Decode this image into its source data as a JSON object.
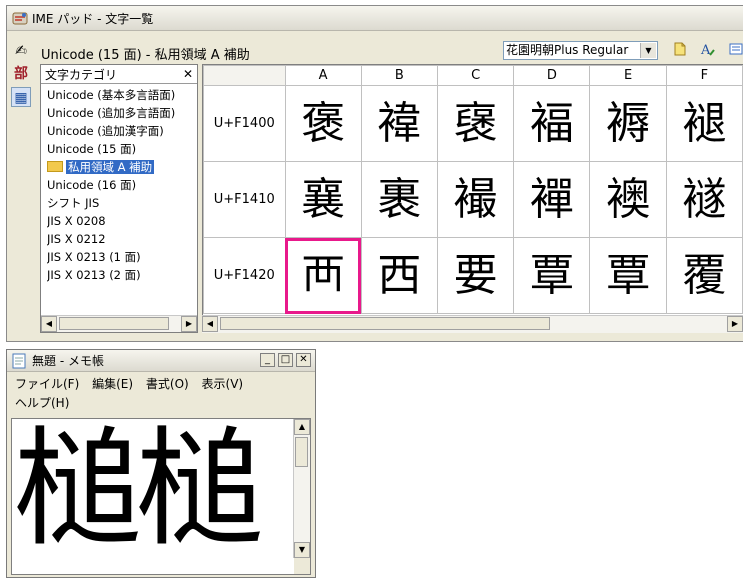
{
  "ime": {
    "title": "IME パッド - 文字一覧",
    "mode_label": "Unicode (15 面) - 私用領域 A 補助",
    "font": "花園明朝Plus Regular",
    "side_buttons": [
      "✍",
      "部",
      "▦"
    ],
    "category_header": "文字カテゴリ",
    "categories": [
      "Unicode (基本多言語面)",
      "Unicode (追加多言語面)",
      "Unicode (追加漢字面)",
      "Unicode (15 面)",
      "私用領域 A 補助",
      "Unicode (16 面)",
      "シフト JIS",
      "JIS X 0208",
      "JIS X 0212",
      "JIS X 0213 (1 面)",
      "JIS X 0213 (2 面)"
    ],
    "selected_category": "私用領域 A 補助",
    "columns": [
      "A",
      "B",
      "C",
      "D",
      "E",
      "F"
    ],
    "rows": [
      {
        "code": "U+F1400",
        "chars": [
          "褒",
          "褘",
          "襃",
          "褔",
          "褥",
          "褪"
        ]
      },
      {
        "code": "U+F1410",
        "chars": [
          "襄",
          "裹",
          "襊",
          "襌",
          "襖",
          "襚"
        ]
      },
      {
        "code": "U+F1420",
        "chars": [
          "襾",
          "西",
          "要",
          "覃",
          "覃",
          "覆"
        ]
      }
    ],
    "selected_cell": "U+F142A"
  },
  "notepad": {
    "title": "無題 - メモ帳",
    "menus": [
      "ファイル(F)",
      "編集(E)",
      "書式(O)",
      "表示(V)",
      "ヘルプ(H)"
    ],
    "content": "槌槌"
  },
  "colors": {
    "selection_highlight": "#e8198b",
    "list_selection": "#316ac5"
  }
}
